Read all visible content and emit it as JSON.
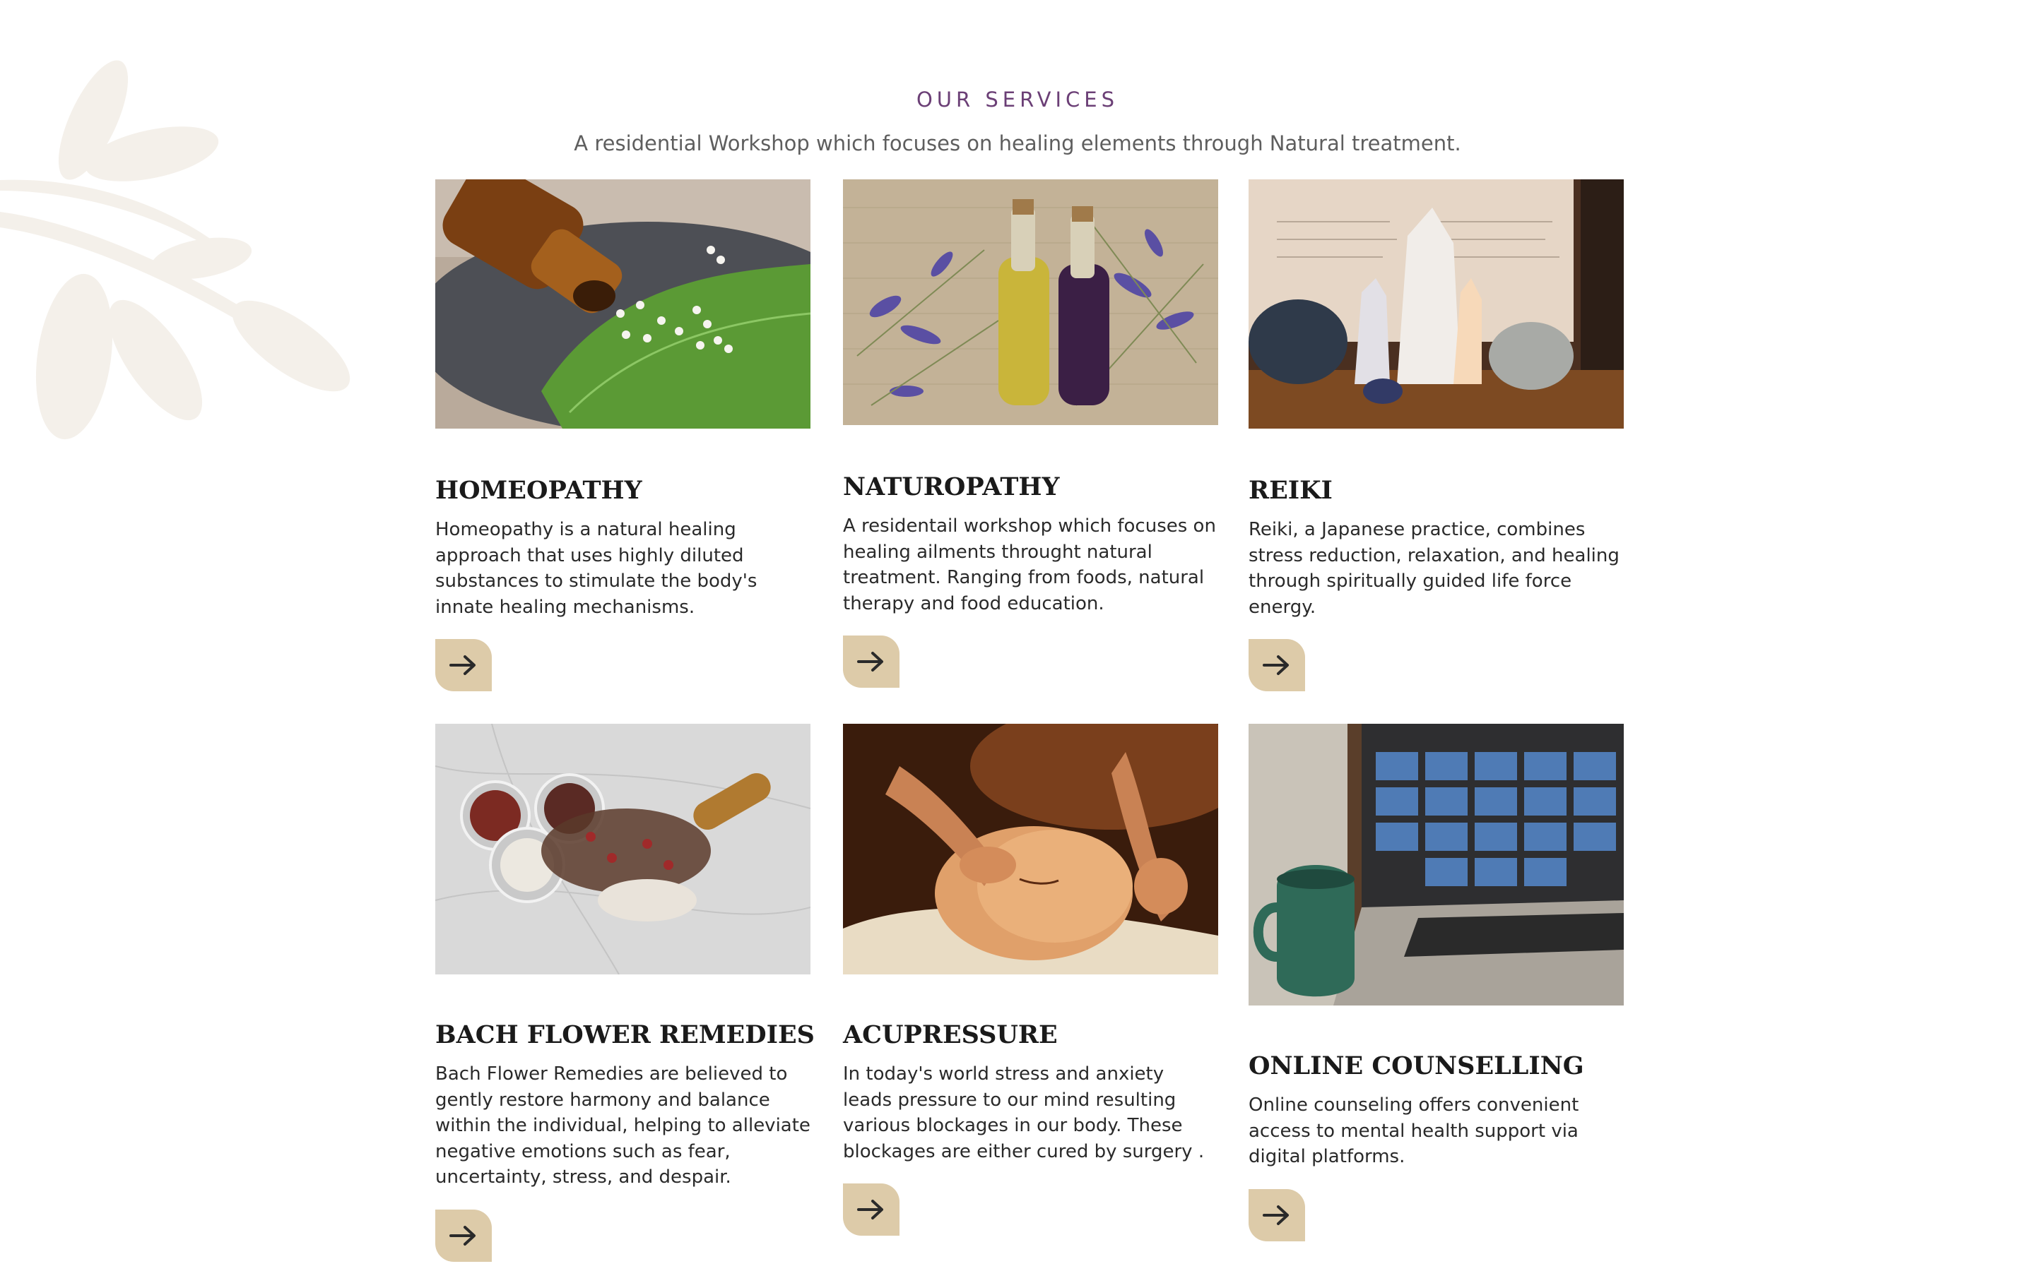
{
  "section": {
    "eyebrow": "OUR SERVICES",
    "subtitle": "A residential Workshop which focuses on healing elements through Natural treatment."
  },
  "colors": {
    "accent": "#6b3f76",
    "button": "#ddcba9",
    "leaf": "#f4f0ea"
  },
  "services": [
    {
      "title": "HOMEOPATHY",
      "description": "Homeopathy is a natural healing approach that uses highly diluted substances to stimulate the body's innate healing mechanisms.",
      "image": "homeopathy-bottle-pills-image",
      "button_icon": "arrow-right-icon"
    },
    {
      "title": "NATUROPATHY",
      "description": "A residentail workshop which focuses on healing ailments throught natural treatment. Ranging from foods, natural therapy and food education.",
      "image": "oil-bottles-lavender-image",
      "button_icon": "arrow-right-icon"
    },
    {
      "title": "REIKI",
      "description": "Reiki, a Japanese practice, combines stress reduction, relaxation, and healing through spiritually guided life force energy.",
      "image": "crystals-image",
      "button_icon": "arrow-right-icon"
    },
    {
      "title": "BACH FLOWER REMEDIES",
      "description": "Bach Flower Remedies are believed to gently restore harmony and balance within the individual, helping to alleviate negative emotions such as fear, uncertainty, stress, and despair.",
      "image": "dried-flowers-salt-image",
      "button_icon": "arrow-right-icon"
    },
    {
      "title": "ACUPRESSURE",
      "description": "In today's world stress and anxiety leads pressure to our mind resulting various blockages in our body. These blockages are either cured by surgery .",
      "image": "face-massage-image",
      "button_icon": "arrow-right-icon"
    },
    {
      "title": "ONLINE COUNSELLING",
      "description": "Online counseling offers convenient access to mental health support via digital platforms.",
      "image": "laptop-video-call-mug-image",
      "button_icon": "arrow-right-icon"
    }
  ]
}
